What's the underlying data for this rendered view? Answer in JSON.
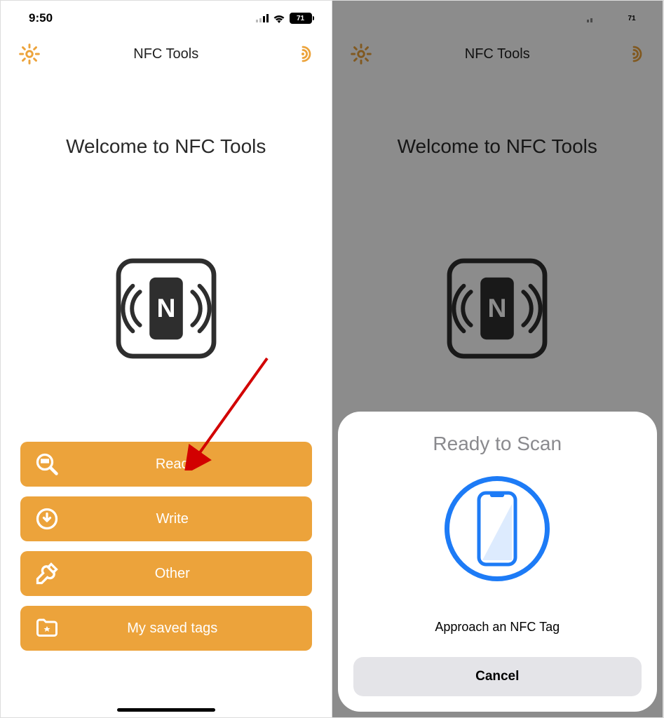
{
  "status": {
    "time": "9:50",
    "battery_percent": "71"
  },
  "nav": {
    "title": "NFC Tools"
  },
  "main": {
    "welcome": "Welcome to NFC Tools"
  },
  "buttons": {
    "read": "Read",
    "write": "Write",
    "other": "Other",
    "saved": "My saved tags"
  },
  "sheet": {
    "title": "Ready to Scan",
    "message": "Approach an NFC Tag",
    "cancel": "Cancel"
  },
  "colors": {
    "accent": "#eca33b",
    "sheet_blue": "#1d7bf6"
  }
}
